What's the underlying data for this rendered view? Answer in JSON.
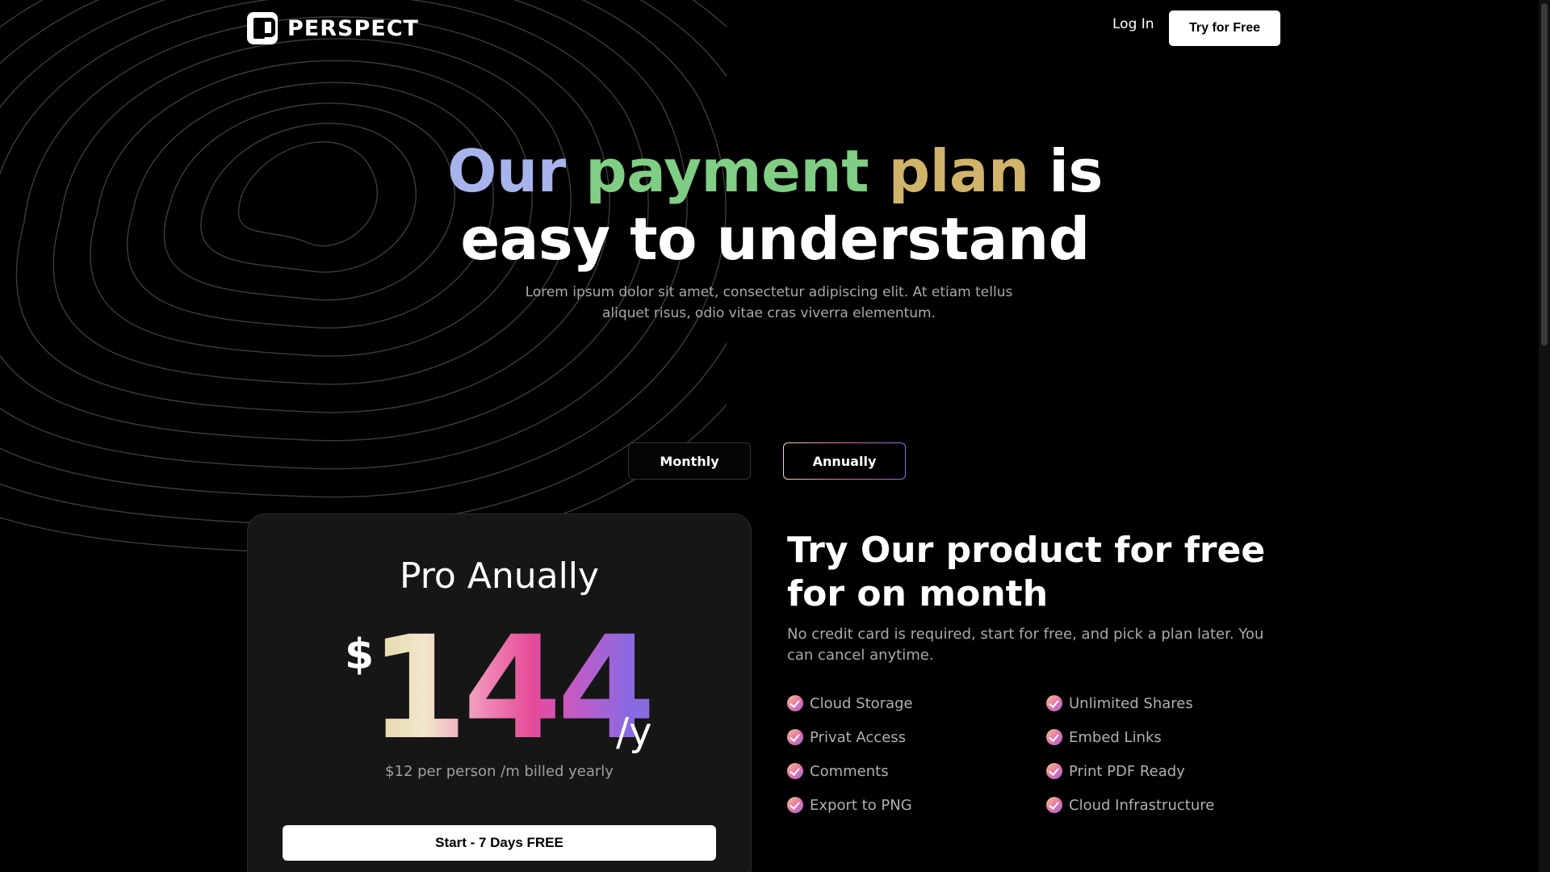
{
  "header": {
    "logo_text": "PERSPECT",
    "login_label": "Log In",
    "try_label": "Try for Free"
  },
  "hero": {
    "title_word_1": "Our",
    "title_word_2": "payment",
    "title_word_3": "plan",
    "title_rest": "is easy to understand",
    "subtitle": "Lorem ipsum dolor sit amet, consectetur adipiscing elit. At etiam tellus aliquet risus, odio vitae cras viverra elementum."
  },
  "billing_toggle": {
    "monthly_label": "Monthly",
    "annually_label": "Annually",
    "selected": "Annually"
  },
  "plan_card": {
    "title": "Pro Anually",
    "currency": "$",
    "price": "144",
    "unit": "/y",
    "note": "$12 per person /m billed yearly",
    "cta_label": "Start - 7 Days FREE"
  },
  "free_trial": {
    "title": "Try Our product for free for on month",
    "subtitle": "No credit card is required, start for free, and pick a plan later. You can cancel anytime."
  },
  "features": [
    "Cloud Storage",
    "Unlimited Shares",
    "Privat Access",
    "Embed Links",
    "Comments",
    "Print PDF Ready",
    "Export to PNG",
    "Cloud Infrastructure"
  ],
  "colors": {
    "background": "#000000",
    "card": "#161616",
    "title_our": "#a7b4ec",
    "title_payment": "#7fce84",
    "title_plan": "#d0b46a",
    "muted_text": "#a9a9a9"
  }
}
